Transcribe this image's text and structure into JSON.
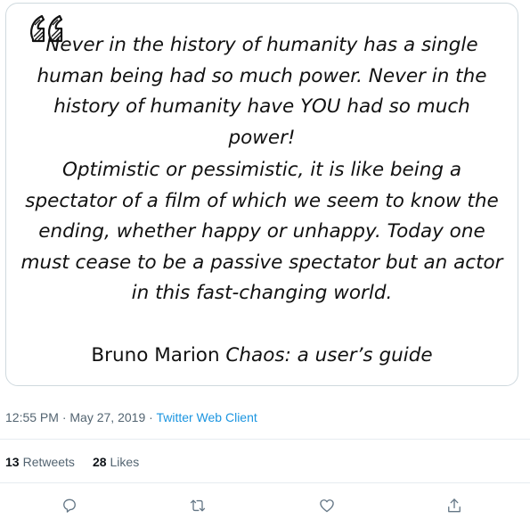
{
  "quote": {
    "paragraph1": "Never in the history of humanity has a single human being had so much power. Never in the history of humanity have YOU had so much power!",
    "paragraph2": "Optimistic or pessimistic, it is like being a spectator of a film of which we seem to know the ending, whether happy or unhappy. Today one must cease to be a passive spectator but an actor in this fast-changing world.",
    "author": "Bruno Marion",
    "book_title": "Chaos: a user’s guide"
  },
  "meta": {
    "time": "12:55 PM",
    "separator1": " · ",
    "date": "May 27, 2019",
    "separator2": " · ",
    "client": "Twitter Web Client"
  },
  "stats": {
    "retweets_count": "13",
    "retweets_label": "Retweets",
    "likes_count": "28",
    "likes_label": "Likes"
  },
  "actions": {
    "icons": [
      "reply-icon",
      "retweet-icon",
      "like-icon",
      "share-icon"
    ]
  },
  "colors": {
    "link": "#1b95e0",
    "muted": "#536471",
    "border": "#cfd9de"
  }
}
